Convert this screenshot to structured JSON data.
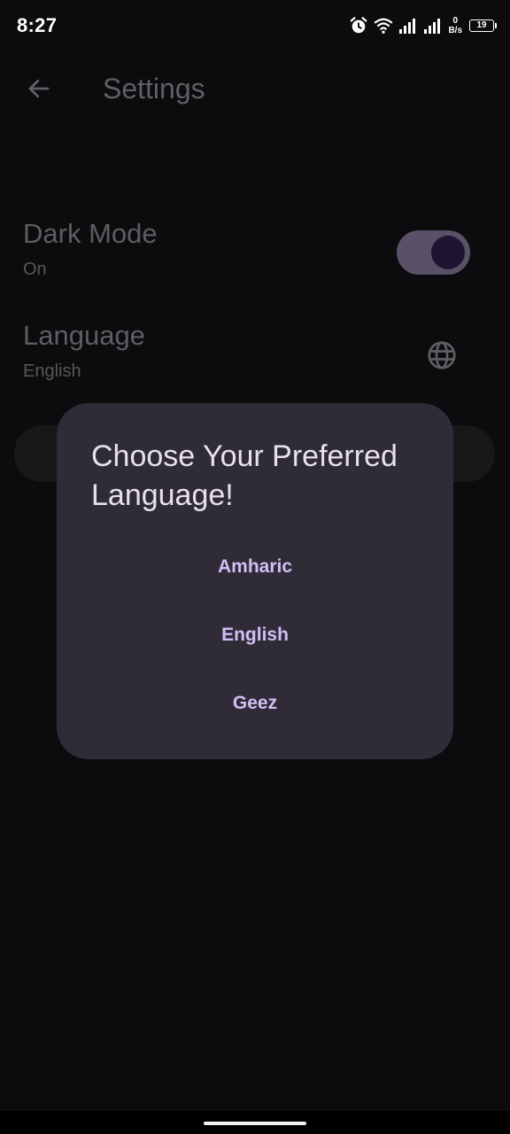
{
  "status_bar": {
    "time": "8:27",
    "net_speed_value": "0",
    "net_speed_unit": "B/s",
    "battery_level": "19"
  },
  "app_bar": {
    "title": "Settings"
  },
  "settings": {
    "dark_mode": {
      "title": "Dark Mode",
      "subtitle": "On",
      "enabled": true
    },
    "language": {
      "title": "Language",
      "subtitle": "English"
    }
  },
  "dialog": {
    "title": "Choose Your Preferred Language!",
    "options": [
      "Amharic",
      "English",
      "Geez"
    ]
  },
  "icons": {
    "back": "arrow-back-icon",
    "language": "globe-icon",
    "alarm": "alarm-icon",
    "wifi": "wifi-icon",
    "signal": "signal-icon",
    "battery": "battery-icon"
  },
  "colors": {
    "background": "#0c0c0e",
    "dialog_background": "#2f2c38",
    "accent": "#d1bff6",
    "toggle_track": "#5a5168",
    "toggle_thumb": "#1d1531"
  }
}
